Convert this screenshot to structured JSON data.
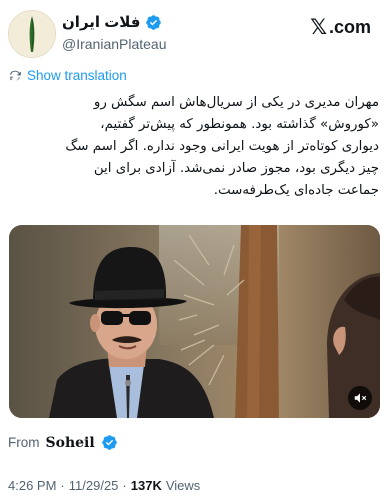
{
  "author": {
    "display_name": "فلات ایران",
    "handle": "@IranianPlateau",
    "verified": true
  },
  "brand": {
    "logo_text": ".com",
    "logo_mark": "𝕏"
  },
  "translation": {
    "label": "Show translation"
  },
  "body_lines": [
    "مهران مدیری در یکی از سریال‌هاش اسم سگش رو",
    "«کوروش» گذاشته بود. همونطور که پیش‌تر گفتیم،",
    "دیواری کوتاه‌تر از هویت ایرانی وجود نداره. اگر اسم سگ",
    "چیز دیگری بود، مجوز صادر نمی‌شد. آزادی برای این",
    "جماعت جاده‌ای یک‌طرفه‌ست."
  ],
  "media": {
    "type": "video",
    "muted": true
  },
  "from": {
    "label": "From",
    "name": "Soheil",
    "verified": true
  },
  "meta": {
    "time": "4:26 PM",
    "separator": "·",
    "date": "11/29/25",
    "views_count": "137K",
    "views_label": "Views"
  },
  "colors": {
    "link": "#1d9bf0",
    "verified": "#1d9bf0",
    "secondary_text": "#536471"
  },
  "icons": [
    "verified-badge-icon",
    "x-logo-icon",
    "translate-icon",
    "mute-icon"
  ]
}
